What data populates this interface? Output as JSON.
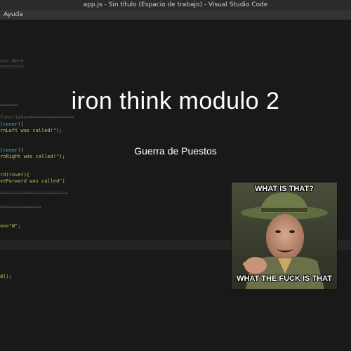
{
  "window": {
    "title": "app.js - Sin título (Espacio de trabajo) - Visual Studio Code"
  },
  "menu": {
    "items": [
      "Ayuda"
    ]
  },
  "code_lines": [
    {
      "text": "ves Here",
      "cls": "cmt"
    },
    {
      "text": "========",
      "cls": "cmt"
    },
    {
      "text": "======",
      "cls": "cmt"
    },
    {
      "text": "functions================",
      "cls": "cmt"
    },
    {
      "text": "(rover){",
      "cls": "var"
    },
    {
      "text": "rnLeft was called!\");",
      "cls": "str"
    },
    {
      "text": "(rover){",
      "cls": "var"
    },
    {
      "text": "rnRight was called!\");",
      "cls": "str"
    },
    {
      "text": "rd(rover){",
      "cls": "fn"
    },
    {
      "text": "veForward was called\")",
      "cls": "str"
    },
    {
      "text": "=======================",
      "cls": "cmt"
    },
    {
      "text": "n=============",
      "cls": "cmt"
    },
    {
      "text": "on=\"W\";",
      "cls": "str"
    },
    {
      "text": "d();",
      "cls": "fn"
    }
  ],
  "slide": {
    "title": "iron think modulo 2",
    "subtitle": "Guerra de Puestos"
  },
  "meme": {
    "top_text": "WHAT IS THAT?",
    "bottom_text": "WHAT THE FUCK IS THAT"
  }
}
